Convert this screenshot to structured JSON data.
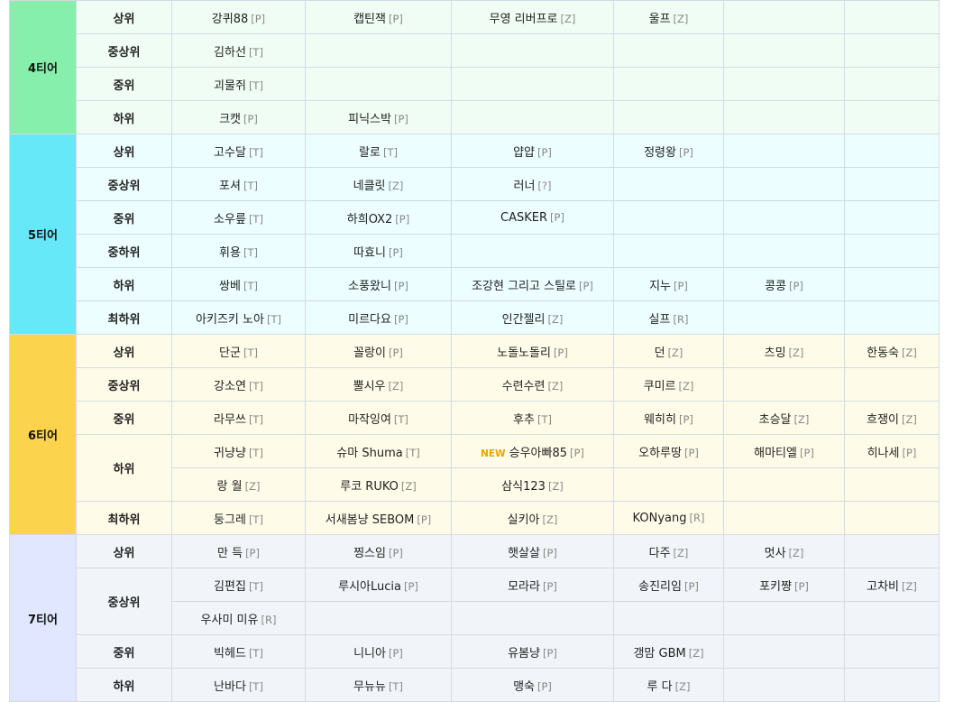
{
  "tiers": [
    {
      "name": "4티어",
      "color": "#86efac",
      "bg": "#f0fdf4",
      "groups": [
        {
          "label": "상위",
          "rows": [
            [
              {
                "n": "강퀴88",
                "t": "[P]"
              },
              {
                "n": "캡틴잭",
                "t": "[P]"
              },
              {
                "n": "무영 리버프로",
                "t": "[Z]"
              },
              {
                "n": "울프",
                "t": "[Z]"
              }
            ]
          ]
        },
        {
          "label": "중상위",
          "rows": [
            [
              {
                "n": "김하선",
                "t": "[T]"
              }
            ]
          ]
        },
        {
          "label": "중위",
          "rows": [
            [
              {
                "n": "괴물쥐",
                "t": "[T]"
              }
            ]
          ]
        },
        {
          "label": "하위",
          "rows": [
            [
              {
                "n": "크캣",
                "t": "[P]"
              },
              {
                "n": "피닉스박",
                "t": "[P]"
              }
            ]
          ]
        }
      ]
    },
    {
      "name": "5티어",
      "color": "#67e8f9",
      "bg": "#ecfeff",
      "groups": [
        {
          "label": "상위",
          "rows": [
            [
              {
                "n": "고수달",
                "t": "[T]"
              },
              {
                "n": "랄로",
                "t": "[T]"
              },
              {
                "n": "얍얍",
                "t": "[P]"
              },
              {
                "n": "정령왕",
                "t": "[P]"
              }
            ]
          ]
        },
        {
          "label": "중상위",
          "rows": [
            [
              {
                "n": "포셔",
                "t": "[T]"
              },
              {
                "n": "네클릿",
                "t": "[Z]"
              },
              {
                "n": "러너",
                "t": "[?]"
              }
            ]
          ]
        },
        {
          "label": "중위",
          "rows": [
            [
              {
                "n": "소우릎",
                "t": "[T]"
              },
              {
                "n": "하희OX2",
                "t": "[P]"
              },
              {
                "n": "CASKER",
                "t": "[P]"
              }
            ]
          ]
        },
        {
          "label": "중하위",
          "rows": [
            [
              {
                "n": "휘용",
                "t": "[T]"
              },
              {
                "n": "따효니",
                "t": "[P]"
              }
            ]
          ]
        },
        {
          "label": "하위",
          "rows": [
            [
              {
                "n": "쌍베",
                "t": "[T]"
              },
              {
                "n": "소풍왔니",
                "t": "[P]"
              },
              {
                "n": "조강현 그리고 스틸로",
                "t": "[P]"
              },
              {
                "n": "지누",
                "t": "[P]"
              },
              {
                "n": "콩콩",
                "t": "[P]"
              }
            ]
          ]
        },
        {
          "label": "최하위",
          "rows": [
            [
              {
                "n": "아키즈키 노아",
                "t": "[T]"
              },
              {
                "n": "미르다요",
                "t": "[P]"
              },
              {
                "n": "인간젤리",
                "t": "[Z]"
              },
              {
                "n": "실프",
                "t": "[R]"
              }
            ]
          ]
        }
      ]
    },
    {
      "name": "6티어",
      "color": "#fcd34d",
      "bg": "#fefce8",
      "groups": [
        {
          "label": "상위",
          "rows": [
            [
              {
                "n": "단군",
                "t": "[T]"
              },
              {
                "n": "꼴랑이",
                "t": "[P]"
              },
              {
                "n": "노돌노돌리",
                "t": "[P]"
              },
              {
                "n": "던",
                "t": "[Z]"
              },
              {
                "n": "츠밍",
                "t": "[Z]"
              },
              {
                "n": "한동숙",
                "t": "[Z]"
              }
            ]
          ]
        },
        {
          "label": "중상위",
          "rows": [
            [
              {
                "n": "강소연",
                "t": "[T]"
              },
              {
                "n": "뿔시우",
                "t": "[Z]"
              },
              {
                "n": "수련수련",
                "t": "[Z]"
              },
              {
                "n": "쿠미르",
                "t": "[Z]"
              }
            ]
          ]
        },
        {
          "label": "중위",
          "rows": [
            [
              {
                "n": "라무쓰",
                "t": "[T]"
              },
              {
                "n": "마작잉여",
                "t": "[T]"
              },
              {
                "n": "후추",
                "t": "[T]"
              },
              {
                "n": "웨히히",
                "t": "[P]"
              },
              {
                "n": "초승달",
                "t": "[Z]"
              },
              {
                "n": "흐쟁이",
                "t": "[Z]"
              }
            ]
          ]
        },
        {
          "label": "하위",
          "rows": [
            [
              {
                "n": "귀냥냥",
                "t": "[T]"
              },
              {
                "n": "슈마 Shuma",
                "t": "[T]"
              },
              {
                "n": "승우아빠85",
                "t": "[P]",
                "badge": "NEW"
              },
              {
                "n": "오하루땅",
                "t": "[P]"
              },
              {
                "n": "해마티엘",
                "t": "[P]"
              },
              {
                "n": "히나세",
                "t": "[P]"
              }
            ],
            [
              {
                "n": "랑 월",
                "t": "[Z]"
              },
              {
                "n": "루코 RUKO",
                "t": "[Z]"
              },
              {
                "n": "삼식123",
                "t": "[Z]"
              }
            ]
          ]
        },
        {
          "label": "최하위",
          "rows": [
            [
              {
                "n": "둥그레",
                "t": "[T]"
              },
              {
                "n": "서새봄냥 SEBOM",
                "t": "[P]"
              },
              {
                "n": "실키아",
                "t": "[Z]"
              },
              {
                "n": "KONyang",
                "t": "[R]"
              }
            ]
          ]
        }
      ]
    },
    {
      "name": "7티어",
      "color": "#e0e7ff",
      "bg": "#f1f5f9",
      "groups": [
        {
          "label": "상위",
          "rows": [
            [
              {
                "n": "만 득",
                "t": "[P]"
              },
              {
                "n": "찡스임",
                "t": "[P]"
              },
              {
                "n": "햇살살",
                "t": "[P]"
              },
              {
                "n": "다주",
                "t": "[Z]"
              },
              {
                "n": "멋사",
                "t": "[Z]"
              }
            ]
          ]
        },
        {
          "label": "중상위",
          "rows": [
            [
              {
                "n": "김편집",
                "t": "[T]"
              },
              {
                "n": "루시아Lucia",
                "t": "[P]"
              },
              {
                "n": "모라라",
                "t": "[P]"
              },
              {
                "n": "송진리임",
                "t": "[P]"
              },
              {
                "n": "포키쨩",
                "t": "[P]"
              },
              {
                "n": "고차비",
                "t": "[Z]"
              }
            ],
            [
              {
                "n": "우사미 미유",
                "t": "[R]"
              }
            ]
          ]
        },
        {
          "label": "중위",
          "rows": [
            [
              {
                "n": "빅헤드",
                "t": "[T]"
              },
              {
                "n": "니니아",
                "t": "[P]"
              },
              {
                "n": "유봄냥",
                "t": "[P]"
              },
              {
                "n": "갱맘 GBM",
                "t": "[Z]"
              }
            ]
          ]
        },
        {
          "label": "하위",
          "rows": [
            [
              {
                "n": "난바다",
                "t": "[T]"
              },
              {
                "n": "무뉴뉴",
                "t": "[T]"
              },
              {
                "n": "맹숙",
                "t": "[P]"
              },
              {
                "n": "루 다",
                "t": "[Z]"
              }
            ]
          ]
        }
      ]
    }
  ]
}
